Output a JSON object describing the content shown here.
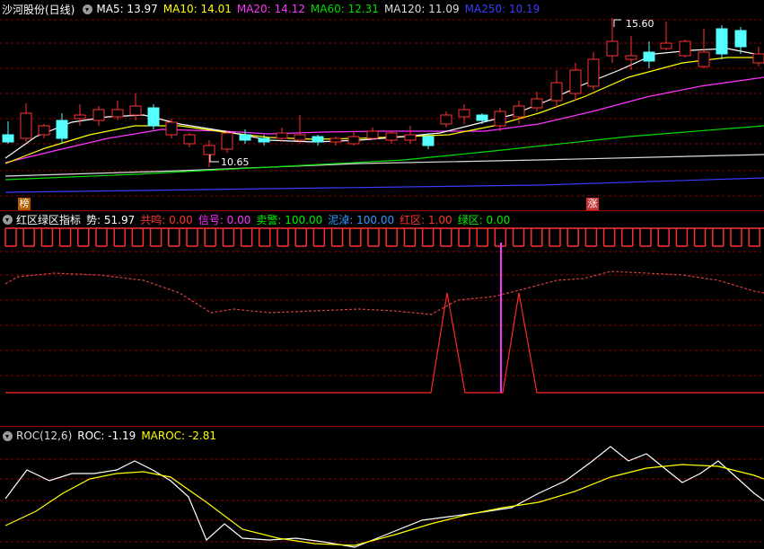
{
  "main": {
    "title": "沙河股份(日线)",
    "ma": [
      {
        "label": "MA5: 13.97",
        "color": "#ffffff"
      },
      {
        "label": "MA10: 14.01",
        "color": "#ffff00"
      },
      {
        "label": "MA20: 14.12",
        "color": "#ff33ff"
      },
      {
        "label": "MA60: 12.31",
        "color": "#00dd00"
      },
      {
        "label": "MA120: 11.09",
        "color": "#dddddd"
      },
      {
        "label": "MA250: 10.19",
        "color": "#3a3aff"
      }
    ],
    "high_label": "15.60",
    "low_label": "10.65",
    "tag_left": "榜",
    "tag_right": "涨"
  },
  "indicator": {
    "title": "红区绿区指标",
    "fields": [
      {
        "label": "势: 51.97",
        "color": "#ffffff"
      },
      {
        "label": "共鸣: 0.00",
        "color": "#ff3333"
      },
      {
        "label": "信号: 0.00",
        "color": "#ff33ff"
      },
      {
        "label": "卖警: 100.00",
        "color": "#00ee00"
      },
      {
        "label": "泥淖: 100.00",
        "color": "#3399ff"
      },
      {
        "label": "红区: 1.00",
        "color": "#ff3333"
      },
      {
        "label": "绿区: 0.00",
        "color": "#00ee00"
      }
    ]
  },
  "roc": {
    "title": "ROC(12,6)",
    "fields": [
      {
        "label": "ROC: -1.19",
        "color": "#ffffff"
      },
      {
        "label": "MAROC: -2.81",
        "color": "#ffff00"
      }
    ]
  },
  "colors": {
    "up": "#ff3232",
    "down": "#54ffff",
    "grid": "#8b0000"
  }
}
